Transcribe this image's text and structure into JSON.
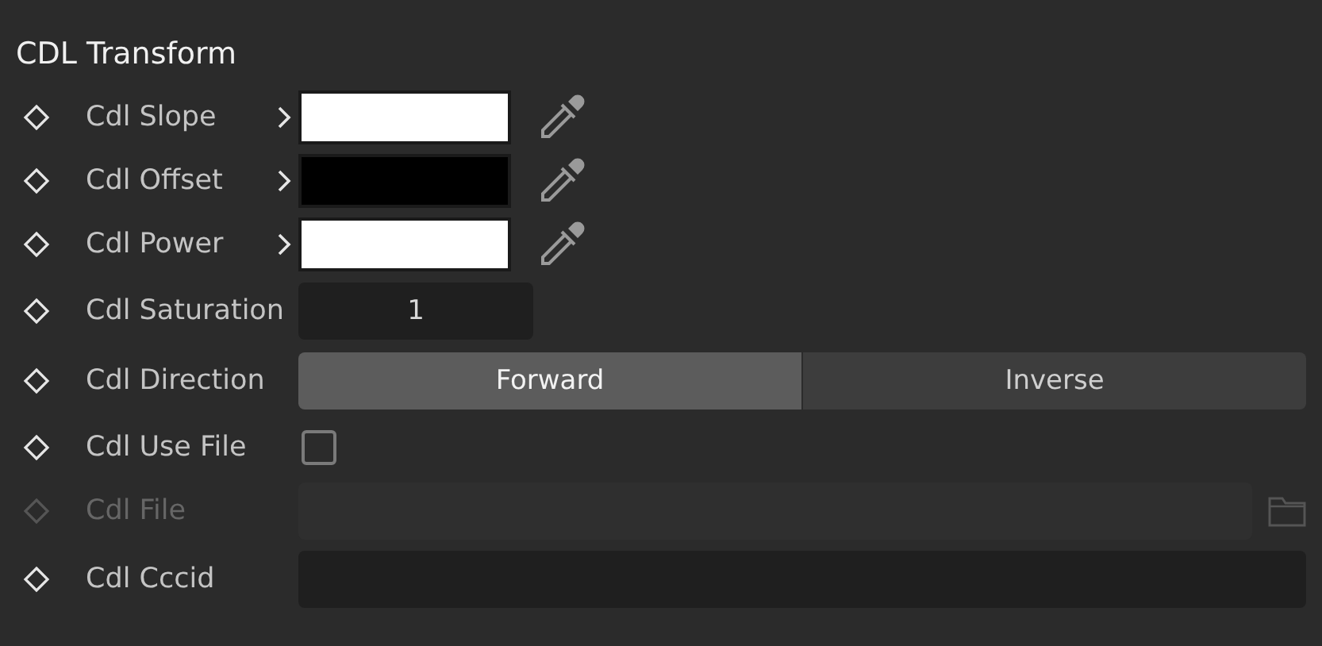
{
  "section": {
    "title": "CDL Transform"
  },
  "params": [
    {
      "kind": "color",
      "label": "Cdl Slope",
      "color": "#ffffff",
      "disabled": false
    },
    {
      "kind": "color",
      "label": "Cdl Offset",
      "color": "#000000",
      "disabled": false
    },
    {
      "kind": "color",
      "label": "Cdl Power",
      "color": "#ffffff",
      "disabled": false
    },
    {
      "kind": "number",
      "label": "Cdl Saturation",
      "value": "1",
      "disabled": false
    },
    {
      "kind": "segmented",
      "label": "Cdl Direction",
      "disabled": false,
      "options": [
        {
          "label": "Forward",
          "selected": true
        },
        {
          "label": "Inverse",
          "selected": false
        }
      ]
    },
    {
      "kind": "checkbox",
      "label": "Cdl Use File",
      "checked": false,
      "disabled": false
    },
    {
      "kind": "file",
      "label": "Cdl File",
      "disabled": true
    },
    {
      "kind": "text",
      "label": "Cdl Cccid",
      "disabled": false
    }
  ]
}
